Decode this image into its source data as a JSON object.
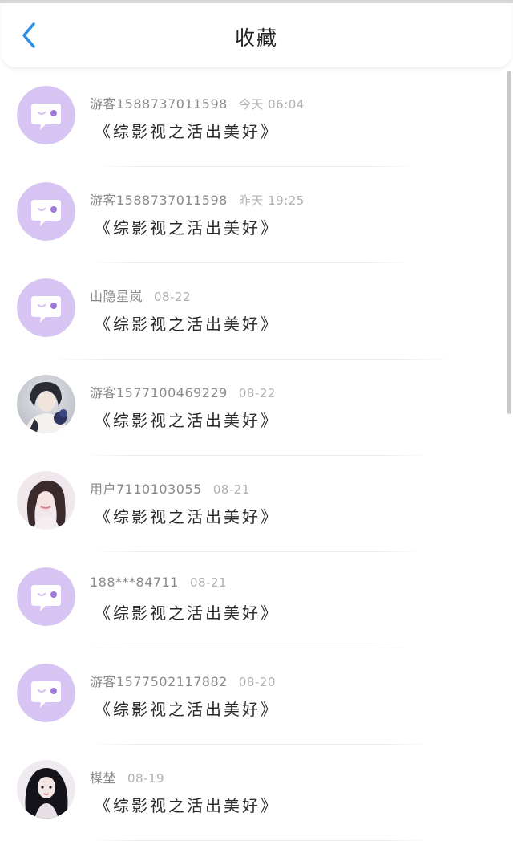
{
  "header": {
    "title": "收藏",
    "back_icon": "chevron-left-icon",
    "accent": "#2b8fe8"
  },
  "colors": {
    "default_avatar_bg": "#d7c4f3",
    "default_avatar_icon": "#ffffff",
    "default_avatar_dot": "#9b7ad8"
  },
  "items": [
    {
      "user": "游客15887370115​98",
      "time": "今天 06:04",
      "book": "《综影视之活出美好》",
      "avatar": "chat-bubble-avatar-icon"
    },
    {
      "user": "游客1588737011598",
      "time": "昨天 19:25",
      "book": "《综影视之活出美好》",
      "avatar": "chat-bubble-avatar-icon"
    },
    {
      "user": "山隐星岚",
      "time": "08-22",
      "book": "《综影视之活出美好》",
      "avatar": "chat-bubble-avatar-icon"
    },
    {
      "user": "游客1577100469229",
      "time": "08-22",
      "book": "《综影视之活出美好》",
      "avatar": "dark-haired-figure-avatar"
    },
    {
      "user": "用户7110103055",
      "time": "08-21",
      "book": "《综影视之活出美好》",
      "avatar": "long-haired-girl-avatar"
    },
    {
      "user": "188***84711",
      "time": "08-21",
      "book": "《综影视之活出美好》",
      "avatar": "chat-bubble-avatar-icon"
    },
    {
      "user": "游客1577502117882",
      "time": "08-20",
      "book": "《综影视之活出美好》",
      "avatar": "chat-bubble-avatar-icon"
    },
    {
      "user": "楳埜",
      "time": "08-19",
      "book": "《综影视之活出美好》",
      "avatar": "black-haired-girl-avatar"
    }
  ]
}
